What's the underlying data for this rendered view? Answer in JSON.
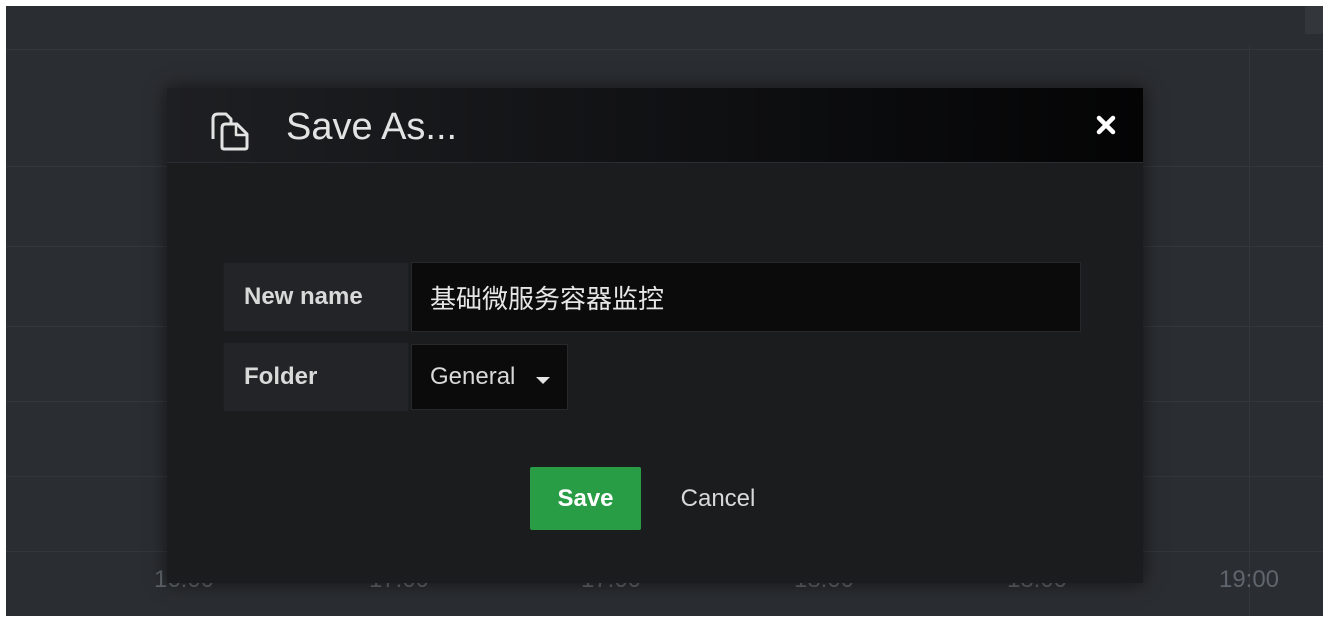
{
  "background": {
    "x_axis_labels": [
      "16:00",
      "17:00",
      "17:00",
      "18:00",
      "18:00",
      "19:00"
    ],
    "colors": {
      "panel": "#2a2d31",
      "grid": "#33373c",
      "axis_text": "#5f656c"
    }
  },
  "modal": {
    "title": "Save As...",
    "header_icon": "copy-icon",
    "close_icon": "close-icon",
    "form": {
      "name_label": "New name",
      "name_value": "基础微服务容器监控",
      "folder_label": "Folder",
      "folder_value": "General",
      "folder_caret_icon": "caret-down-icon"
    },
    "buttons": {
      "save_label": "Save",
      "cancel_label": "Cancel"
    },
    "colors": {
      "modal_bg": "#1b1c1e",
      "input_bg": "#0b0b0c",
      "label_bg": "#232427",
      "primary": "#299c46",
      "text": "#d9d9d9"
    }
  }
}
